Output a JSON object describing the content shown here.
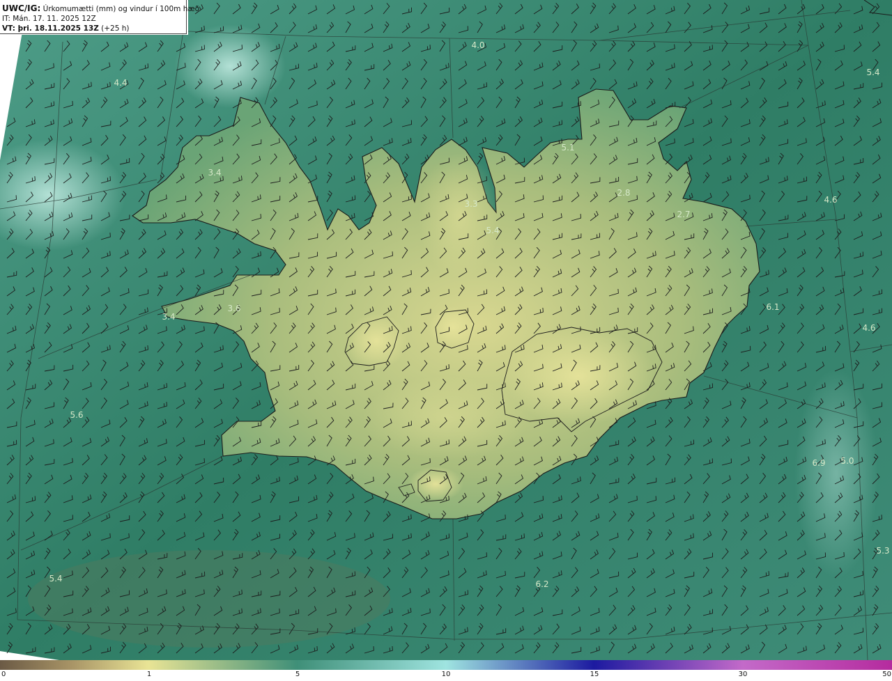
{
  "header": {
    "model": "UWC/IG:",
    "description": "Úrkomumætti (mm) og vindur í 100m hæð",
    "it_line": "IT: Mán. 17. 11. 2025 12Z",
    "vt_bold": "VT: þri. 18.11.2025 13Z",
    "vt_suffix": "(+25 h)"
  },
  "map_labels": [
    "4.0",
    "5.4",
    "4.4",
    "5.1",
    "3.4",
    "2.8",
    "4.6",
    "3.3",
    "2.7",
    "5.4",
    "3.6",
    "6.1",
    "3.4",
    "4.6",
    "5.6",
    "6.9",
    "5.0",
    "5.3",
    "5.4",
    "6.2"
  ],
  "colorbar": {
    "ticks": [
      "0",
      "1",
      "5",
      "10",
      "15",
      "30",
      "50"
    ],
    "colors": [
      "#6b5a45",
      "#a89466",
      "#e9e495",
      "#3f8f78",
      "#9fe4e0",
      "#1c1aa0",
      "#c36ac9",
      "#b52b9e"
    ]
  },
  "colors": {
    "land_base": "#c8cc86",
    "sea_base": "#3c8a72",
    "coast": "#1a1a1a"
  }
}
